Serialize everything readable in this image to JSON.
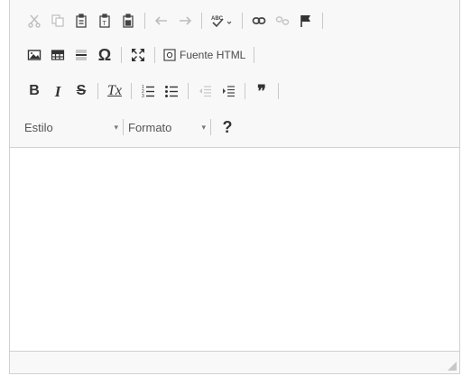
{
  "toolbar": {
    "row1": {
      "icons": [
        "cut-icon",
        "copy-icon",
        "paste-icon",
        "paste-text-icon",
        "paste-word-icon",
        "undo-icon",
        "redo-icon",
        "spellcheck-icon",
        "link-icon",
        "unlink-icon",
        "anchor-icon"
      ]
    },
    "row2": {
      "icons": [
        "image-icon",
        "table-icon",
        "horizontal-line-icon",
        "special-char-icon",
        "maximize-icon",
        "source-icon"
      ],
      "special_char_glyph": "Ω",
      "source_label": "Fuente HTML"
    },
    "row3": {
      "bold_glyph": "B",
      "italic_glyph": "I",
      "strike_glyph": "S",
      "remove_format_glyph": "Tx",
      "icons": [
        "numbered-list-icon",
        "bulleted-list-icon",
        "outdent-icon",
        "indent-icon"
      ],
      "blockquote_glyph": "❞"
    },
    "row4": {
      "style_label": "Estilo",
      "format_label": "Formato",
      "help_glyph": "?"
    }
  },
  "colors": {
    "toolbar_bg": "#f8f8f8",
    "border": "#d1d1d1",
    "icon_dark": "#333333",
    "icon_disabled": "#bbbbbb"
  }
}
